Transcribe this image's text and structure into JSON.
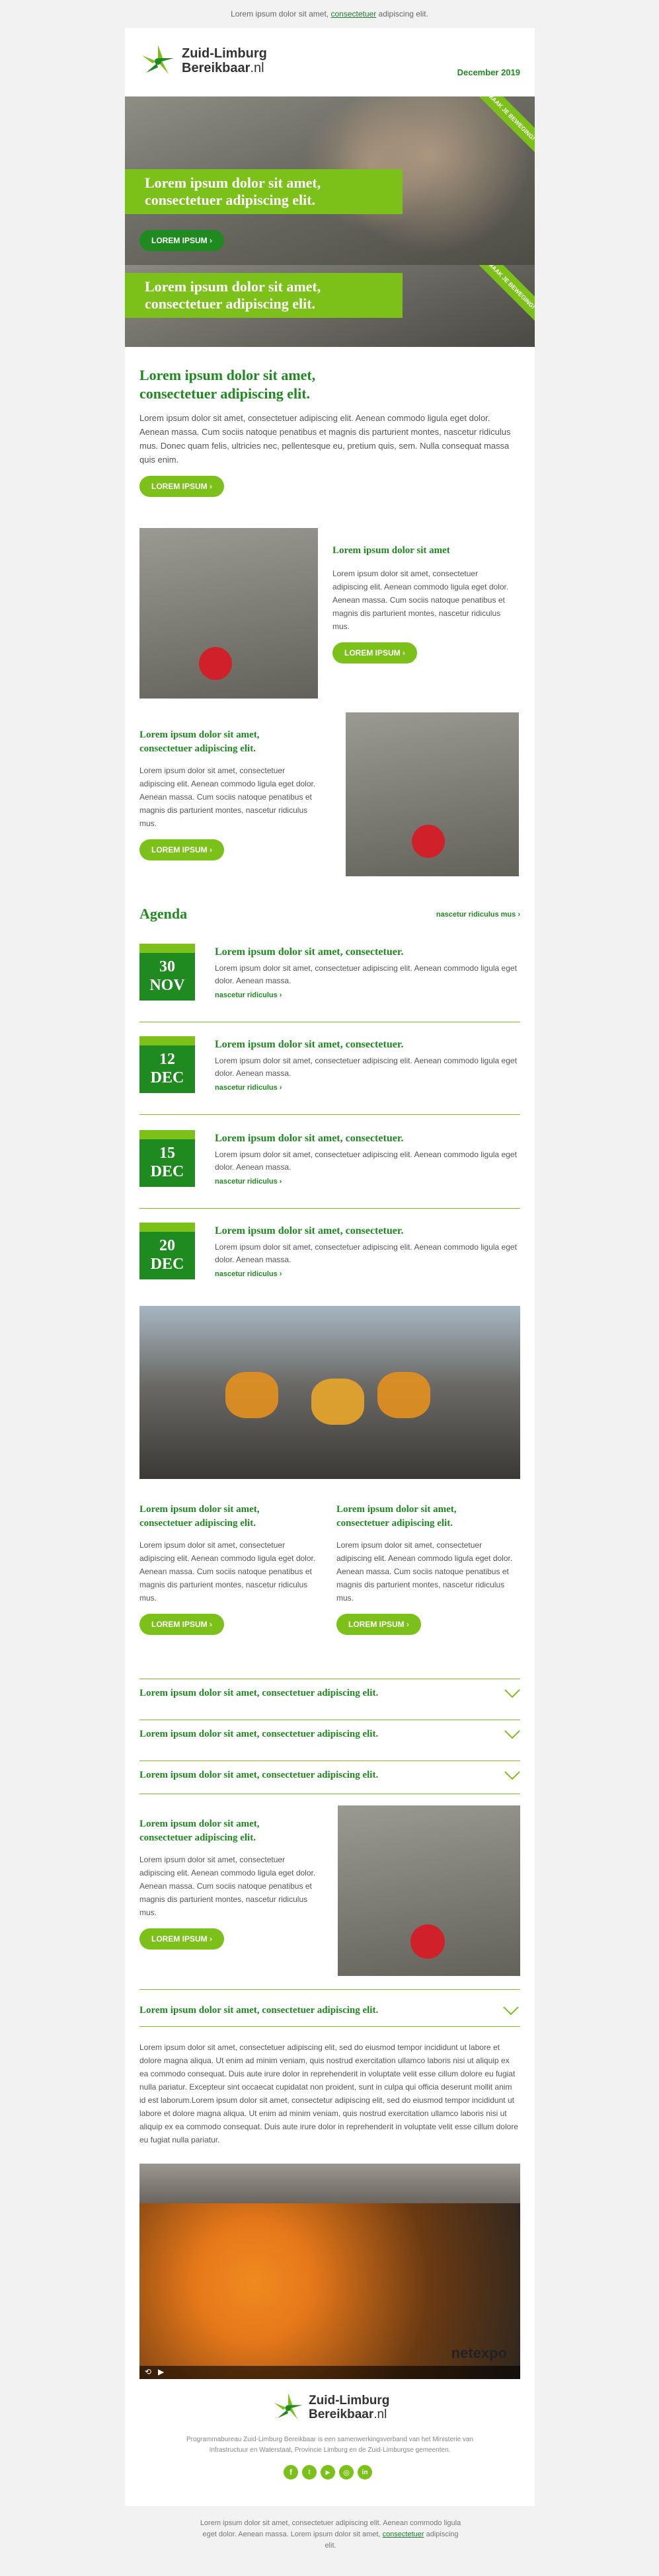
{
  "preheader": {
    "text": "Lorem ipsum dolor sit amet,",
    "link": "consectetuer",
    "text2": "adipiscing elit."
  },
  "logo": {
    "line1": "Zuid-Limburg",
    "line2a": "Bereikbaar",
    "line2b": ".nl"
  },
  "date": "December 2019",
  "hero": [
    {
      "title_line1": "Lorem ipsum dolor sit amet,",
      "title_line2": "consectetuer adipiscing elit.",
      "button": "LOREM IPSUM ›",
      "ribbon": "MAAK JE BEWEGING!"
    },
    {
      "title_line1": "Lorem ipsum dolor sit amet,",
      "title_line2": "consectetuer adipiscing elit.",
      "ribbon": "MAAK JE BEWEGING!"
    }
  ],
  "intro": {
    "title_line1": "Lorem ipsum dolor sit amet,",
    "title_line2": "consectetuer adipiscing elit.",
    "text": "Lorem ipsum dolor sit amet, consectetuer adipiscing elit. Aenean commodo ligula eget dolor. Aenean massa. Cum sociis natoque penatibus et magnis dis parturient montes, nascetur ridiculus mus. Donec quam felis, ultricies nec, pellentesque eu, pretium quis, sem. Nulla consequat massa quis enim.",
    "button": "LOREM IPSUM ›"
  },
  "feature1": {
    "title": "Lorem ipsum dolor sit amet",
    "text": "Lorem ipsum dolor sit amet, consectetuer adipiscing elit. Aenean commodo ligula eget dolor. Aenean massa. Cum sociis natoque penatibus et magnis dis parturient montes, nascetur ridiculus mus.",
    "button": "LOREM IPSUM ›"
  },
  "feature2": {
    "title_line1": "Lorem ipsum dolor sit amet,",
    "title_line2": "consectetuer adipiscing elit.",
    "text": "Lorem ipsum dolor sit amet, consectetuer adipiscing elit. Aenean commodo ligula eget dolor. Aenean massa. Cum sociis natoque penatibus et magnis dis parturient montes, nascetur ridiculus mus.",
    "button": "LOREM IPSUM ›"
  },
  "agenda": {
    "title": "Agenda",
    "more": "nascetur ridiculus mus ›",
    "items": [
      {
        "day": "30",
        "month": "NOV",
        "title": "Lorem ipsum dolor sit amet, consectetuer.",
        "text": "Lorem ipsum dolor sit amet, consectetuer adipiscing elit. Aenean commodo ligula eget dolor. Aenean massa.",
        "link": "nascetur ridiculus ›"
      },
      {
        "day": "12",
        "month": "DEC",
        "title": "Lorem ipsum dolor sit amet, consectetuer.",
        "text": "Lorem ipsum dolor sit amet, consectetuer adipiscing elit. Aenean commodo ligula eget dolor. Aenean massa.",
        "link": "nascetur ridiculus ›"
      },
      {
        "day": "15",
        "month": "DEC",
        "title": "Lorem ipsum dolor sit amet, consectetuer.",
        "text": "Lorem ipsum dolor sit amet, consectetuer adipiscing elit. Aenean commodo ligula eget dolor. Aenean massa.",
        "link": "nascetur ridiculus ›"
      },
      {
        "day": "20",
        "month": "DEC",
        "title": "Lorem ipsum dolor sit amet, consectetuer.",
        "text": "Lorem ipsum dolor sit amet, consectetuer adipiscing elit. Aenean commodo ligula eget dolor. Aenean massa.",
        "link": "nascetur ridiculus ›"
      }
    ]
  },
  "two_col": [
    {
      "title_line1": "Lorem ipsum dolor sit amet,",
      "title_line2": "consectetuer adipiscing elit.",
      "text": "Lorem ipsum dolor sit amet, consectetuer adipiscing elit. Aenean commodo ligula eget dolor. Aenean massa. Cum sociis natoque penatibus et magnis dis parturient montes, nascetur ridiculus mus.",
      "button": "LOREM IPSUM ›"
    },
    {
      "title_line1": "Lorem ipsum dolor sit amet,",
      "title_line2": "consectetuer adipiscing elit.",
      "text": "Lorem ipsum dolor sit amet, consectetuer adipiscing elit. Aenean commodo ligula eget dolor. Aenean massa. Cum sociis natoque penatibus et magnis dis parturient montes, nascetur ridiculus mus.",
      "button": "LOREM IPSUM ›"
    }
  ],
  "accordion": [
    "Lorem ipsum dolor sit amet, consectetuer adipiscing elit.",
    "Lorem ipsum dolor sit amet, consectetuer adipiscing elit.",
    "Lorem ipsum dolor sit amet, consectetuer adipiscing elit."
  ],
  "feature3": {
    "title_line1": "Lorem ipsum dolor sit amet,",
    "title_line2": "consectetuer adipiscing elit.",
    "text": "Lorem ipsum dolor sit amet, consectetuer adipiscing elit. Aenean commodo ligula eget dolor. Aenean massa. Cum sociis natoque penatibus et magnis dis parturient montes, nascetur ridiculus mus.",
    "button": "LOREM IPSUM ›"
  },
  "accordion_open": {
    "title": "Lorem ipsum dolor sit amet, consectetuer adipiscing elit.",
    "text": "Lorem ipsum dolor sit amet, consectetuer adipiscing elit, sed do eiusmod tempor incididunt ut labore et dolore magna aliqua. Ut enim ad minim veniam, quis nostrud exercitation ullamco laboris nisi ut aliquip ex ea commodo consequat. Duis aute irure dolor in reprehenderit in voluptate velit esse cillum dolore eu fugiat nulla pariatur. Excepteur sint occaecat cupidatat non proident, sunt in culpa qui officia deserunt mollit anim id est laborum.Lorem ipsum dolor sit amet, consectetur adipiscing elit, sed do eiusmod tempor incididunt ut labore et dolore magna aliqua. Ut enim ad minim veniam, quis nostrud exercitation ullamco laboris nisi ut aliquip ex ea commodo consequat. Duis aute irure dolor in reprehenderit in voluptate velit esse cillum dolore eu fugiat nulla pariatur."
  },
  "video": {
    "watermark": "netexpo"
  },
  "footer": {
    "text": "Programmabureau Zuid-Limburg Bereikbaar is een samenwerkingsverband van het Ministerie van Infrastructuur en Waterstaat, Provincie Limburg en de Zuid-Limburgse gemeenten.",
    "social": [
      "facebook-icon",
      "twitter-icon",
      "youtube-icon",
      "instagram-icon",
      "linkedin-icon"
    ]
  },
  "postfooter": {
    "text": "Lorem ipsum dolor sit amet, consectetuer adipiscing elit. Aenean commodo ligula eget dolor. Aenean massa. Lorem ipsum dolor sit amet,",
    "link": "consectetuer",
    "text2": "adipiscing elit."
  },
  "colors": {
    "green_dark": "#1f8a1f",
    "green_light": "#7cc11a",
    "background": "#f2f2f2"
  }
}
